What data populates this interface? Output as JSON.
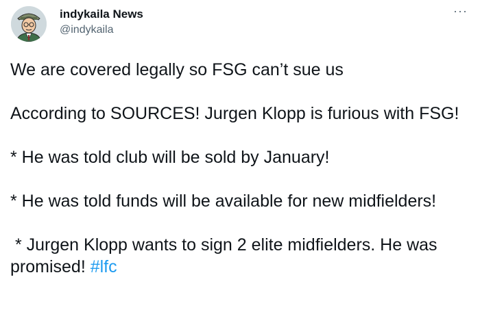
{
  "author": {
    "name": "indykaila News",
    "handle": "@indykaila"
  },
  "more_label": "···",
  "tweet": {
    "paragraphs": [
      "We are covered legally so FSG can’t sue us",
      "According to SOURCES! Jurgen Klopp is furious with FSG!",
      "* He was told club will be sold by January!",
      "* He was told funds will be available for new midfielders!"
    ],
    "last_paragraph_text": " * Jurgen Klopp wants to sign 2 elite midfielders. He was promised! ",
    "hashtag": "#lfc"
  },
  "colors": {
    "text": "#0f1419",
    "secondary": "#536471",
    "link": "#1d9bf0"
  }
}
